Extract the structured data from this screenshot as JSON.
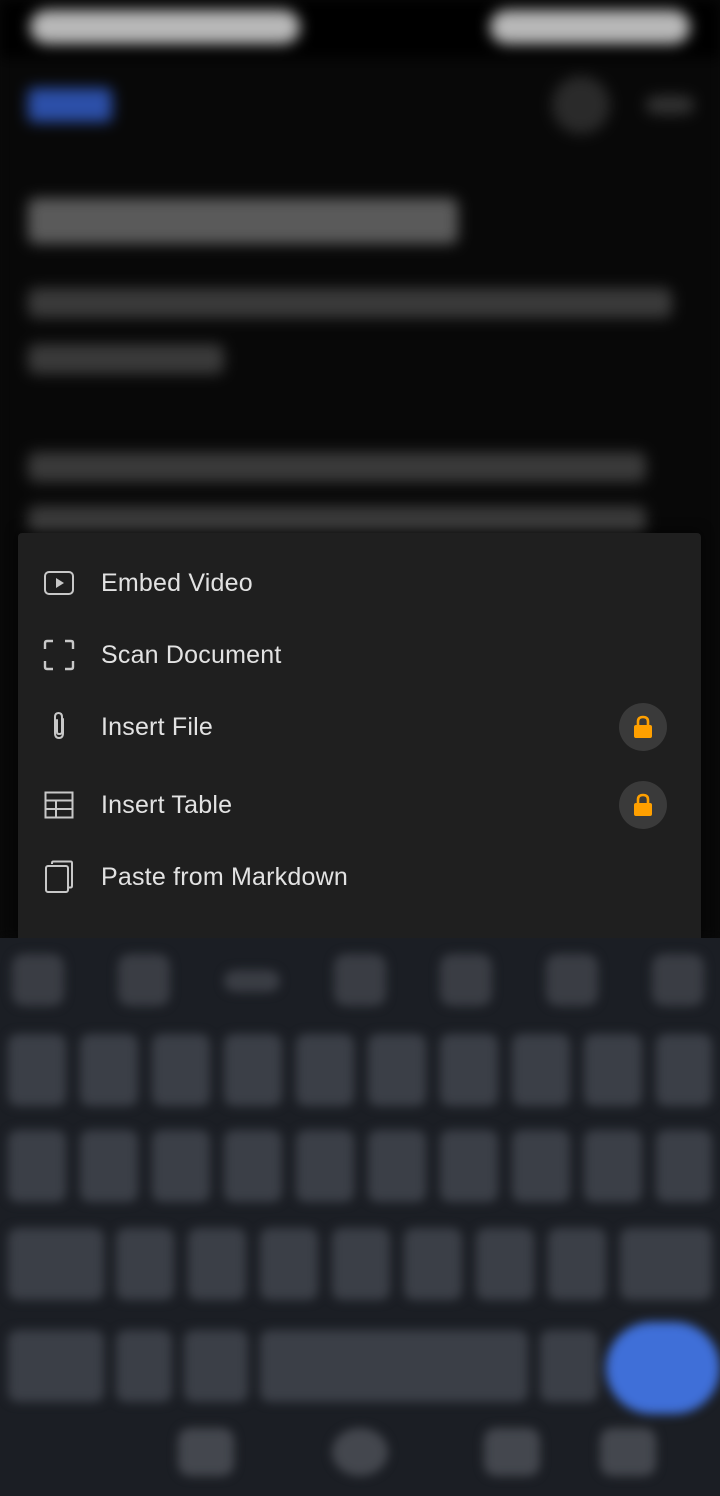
{
  "menu": {
    "items": [
      {
        "label": "Embed Video",
        "icon": "video-play-icon",
        "locked": false
      },
      {
        "label": "Scan Document",
        "icon": "scan-frame-icon",
        "locked": false
      },
      {
        "label": "Insert File",
        "icon": "paperclip-icon",
        "locked": true
      },
      {
        "label": "Insert Table",
        "icon": "table-grid-icon",
        "locked": true
      },
      {
        "label": "Paste from Markdown",
        "icon": "copy-pages-icon",
        "locked": false
      }
    ]
  },
  "colors": {
    "menu_background": "#1f1f1f",
    "menu_text": "#e2e2e2",
    "icon": "#c8c8c8",
    "lock_badge": "#3a3a3a",
    "lock": "#ffa000",
    "keyboard_background": "#1b1e24",
    "keyboard_enter": "#3f6fd8"
  }
}
